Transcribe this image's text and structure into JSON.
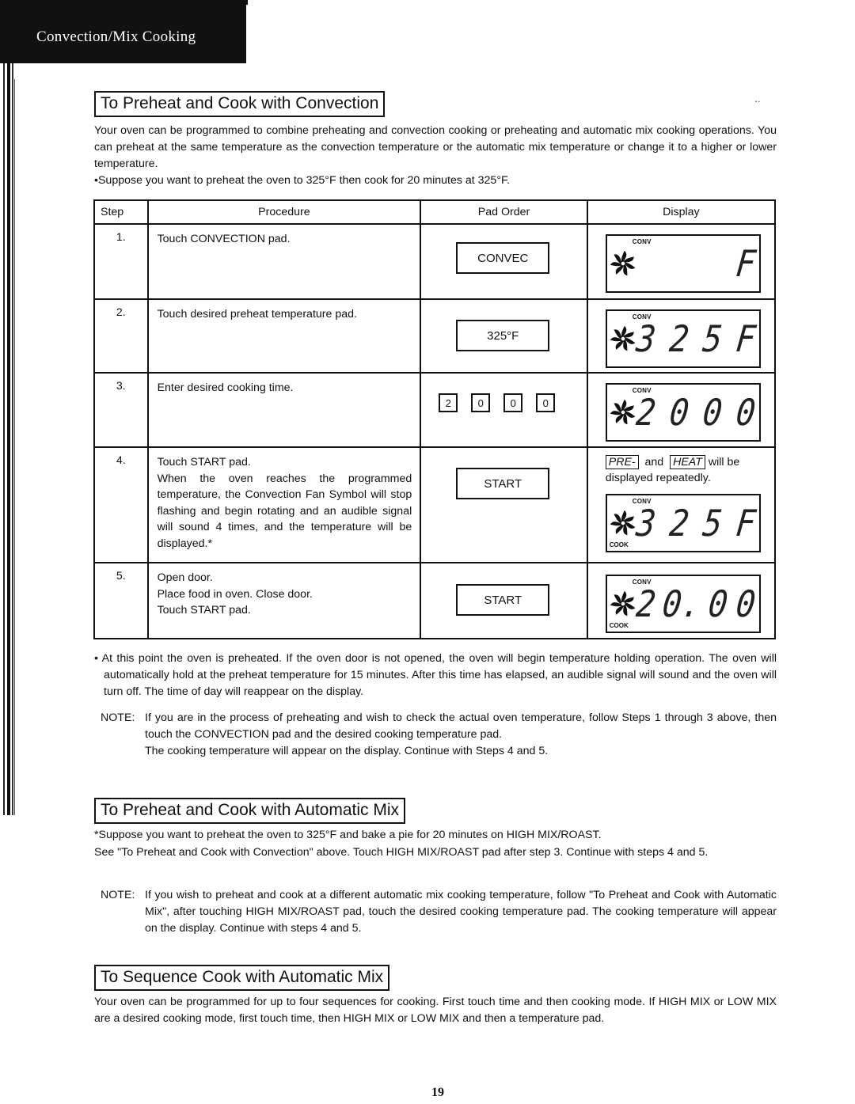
{
  "header": {
    "title": "Convection/Mix Cooking"
  },
  "section1": {
    "heading": "To Preheat and Cook with Convection",
    "intro": "Your oven can be programmed to combine preheating and convection cooking or preheating and automatic mix cooking operations. You can preheat at the same temperature as the convection temperature or the automatic mix temperature or change it to a higher or lower temperature.",
    "example": "•Suppose you want to preheat the oven to 325°F then cook for 20 minutes at 325°F.",
    "table": {
      "headers": {
        "step": "Step",
        "procedure": "Procedure",
        "pad_order": "Pad Order",
        "display": "Display"
      },
      "rows": [
        {
          "step": "1.",
          "procedure": "Touch CONVECTION pad.",
          "pad": "CONVEC",
          "display": {
            "top_label": "CONV",
            "bottom_label": "",
            "digits": [
              "",
              "",
              "",
              "F"
            ]
          }
        },
        {
          "step": "2.",
          "procedure": "Touch desired preheat temperature pad.",
          "pad": "325°F",
          "display": {
            "top_label": "CONV",
            "bottom_label": "",
            "digits": [
              "3",
              "2",
              "5",
              "F"
            ]
          }
        },
        {
          "step": "3.",
          "procedure": "Enter desired cooking time.",
          "keys": [
            "2",
            "0",
            "0",
            "0"
          ],
          "display": {
            "top_label": "CONV",
            "bottom_label": "",
            "digits": [
              "2",
              "0",
              "0",
              "0"
            ]
          }
        },
        {
          "step": "4.",
          "procedure_lines": [
            "Touch START pad.",
            "When the oven reaches the programmed temperature, the Convection Fan Symbol will stop flashing and begin rotating and an audible signal will sound 4 times, and the temperature will be displayed.*"
          ],
          "pad": "START",
          "note": {
            "pre": "PRE-",
            "and": "and",
            "heat": "HEAT",
            "suffix": "will be",
            "line2": "displayed repeatedly."
          },
          "display": {
            "top_label": "CONV",
            "bottom_label": "COOK",
            "digits": [
              "3",
              "2",
              "5",
              "F"
            ]
          }
        },
        {
          "step": "5.",
          "procedure_lines": [
            "Open door.",
            "Place food in oven.  Close door.",
            "Touch START pad."
          ],
          "pad": "START",
          "display": {
            "top_label": "CONV",
            "bottom_label": "COOK",
            "digits": [
              "2",
              "0.",
              "0",
              "0"
            ]
          }
        }
      ]
    },
    "bullet": "• At this point the oven is preheated.  If the oven door is not opened, the oven will begin temperature holding operation. The oven will automatically hold at the preheat temperature for 15 minutes.  After this time has elapsed, an audible signal will sound and the oven will turn off.  The time of day will reappear on the display.",
    "note_label": "NOTE:",
    "note_body": "If you are in the process of preheating and wish to check the actual oven temperature, follow Steps 1 through 3 above, then touch the CONVECTION pad and the desired cooking temperature pad.",
    "note_body2": "The cooking temperature will appear on the display.  Continue with Steps 4 and 5."
  },
  "section2": {
    "heading": "To Preheat and Cook with Automatic Mix",
    "example": "*Suppose you want to preheat the oven to 325°F and bake a pie for 20 minutes on HIGH MIX/ROAST.",
    "text": "See \"To Preheat and Cook with Convection\" above.  Touch HIGH MIX/ROAST pad after step 3.  Continue with steps 4 and 5.",
    "note_label": "NOTE:",
    "note_body": "If you wish to preheat and cook at a different automatic mix cooking temperature, follow \"To Preheat and Cook with Automatic Mix\", after touching HIGH MIX/ROAST pad, touch the desired cooking temperature pad.  The cooking temperature will appear on the display.  Continue with steps 4 and 5."
  },
  "section3": {
    "heading": "To Sequence Cook with Automatic Mix",
    "text": "Your oven can be programmed for up to four sequences for cooking.  First touch time and then cooking mode.  If HIGH MIX or LOW MIX are a desired cooking mode, first touch time, then HIGH MIX or LOW MIX and then a temperature pad."
  },
  "footer": {
    "page_number": "19"
  },
  "icons": {
    "fan": "convection-fan-icon"
  }
}
